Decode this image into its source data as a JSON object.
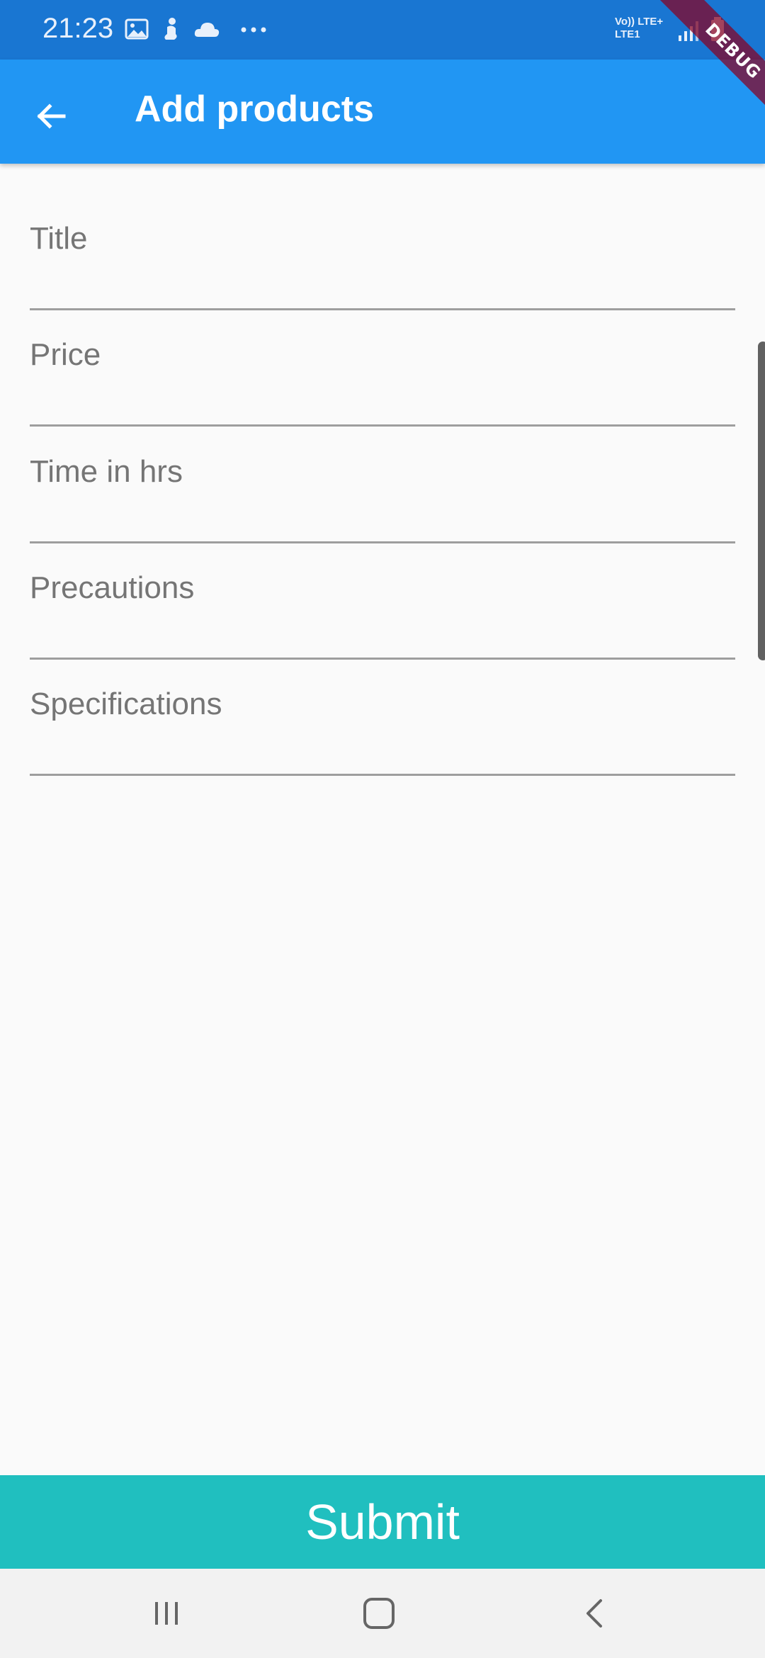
{
  "status_bar": {
    "time": "21:23",
    "icons": [
      "gallery-icon",
      "person-icon",
      "cloud-icon",
      "more-dots-icon"
    ],
    "network_line1": "Vo)) LTE+",
    "network_line2": "LTE1",
    "right_icons": [
      "signal-icon",
      "battery-icon"
    ]
  },
  "debug_banner": "DEBUG",
  "app_bar": {
    "title": "Add products",
    "back_icon": "arrow-back-icon",
    "color": "#2196f3"
  },
  "form": {
    "fields": [
      {
        "label": "Title",
        "value": ""
      },
      {
        "label": "Price",
        "value": ""
      },
      {
        "label": "Time in hrs",
        "value": ""
      },
      {
        "label": "Precautions",
        "value": ""
      },
      {
        "label": "Specifications",
        "value": ""
      }
    ]
  },
  "submit": {
    "label": "Submit",
    "color": "#20bfbf"
  },
  "nav_bar": {
    "buttons": [
      "recents-icon",
      "home-icon",
      "back-icon"
    ]
  }
}
